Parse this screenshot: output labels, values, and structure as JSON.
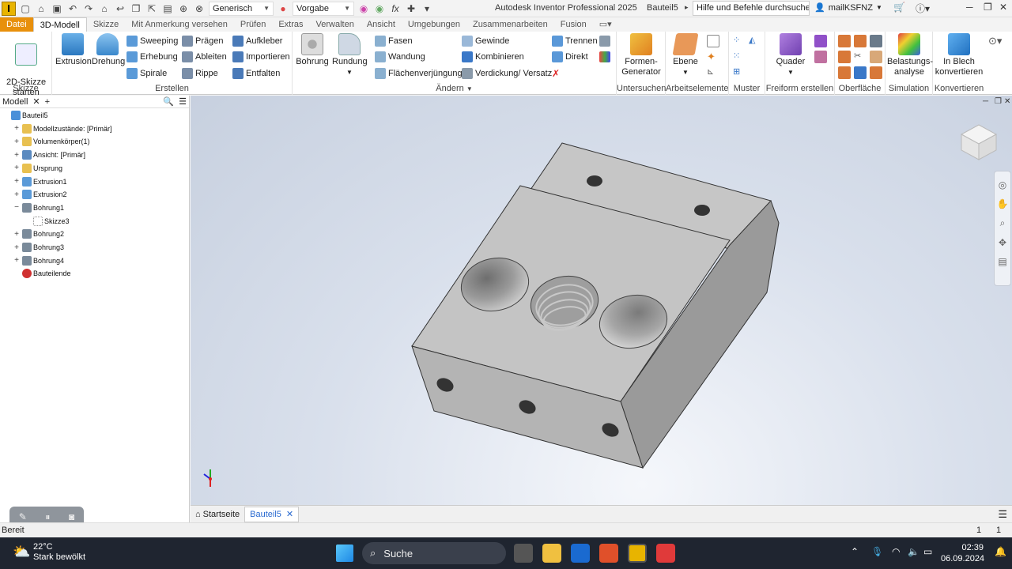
{
  "app": {
    "title": "Autodesk Inventor Professional 2025",
    "doc": "Bauteil5",
    "search_placeholder": "Hilfe und Befehle durchsuchen...",
    "user": "mailKSFNZ",
    "appearance": "Generisch",
    "material": "Vorgabe",
    "fx": "fx"
  },
  "menu_tabs": [
    "Datei",
    "3D-Modell",
    "Skizze",
    "Mit Anmerkung versehen",
    "Prüfen",
    "Extras",
    "Verwalten",
    "Ansicht",
    "Umgebungen",
    "Zusammenarbeiten",
    "Fusion"
  ],
  "ribbon": {
    "skizze": {
      "label": "Skizze",
      "btn": "2D-Skizze\nstarten"
    },
    "erstellen": {
      "label": "Erstellen",
      "extrusion": "Extrusion",
      "drehung": "Drehung",
      "sweeping": "Sweeping",
      "erhebung": "Erhebung",
      "spirale": "Spirale",
      "praegen": "Prägen",
      "ableiten": "Ableiten",
      "rippe": "Rippe",
      "aufkleber": "Aufkleber",
      "importieren": "Importieren",
      "entfalten": "Entfalten"
    },
    "aendern": {
      "label": "Ändern",
      "bohrung": "Bohrung",
      "rundung": "Rundung",
      "fasen": "Fasen",
      "wandung": "Wandung",
      "flaechen": "Flächenverjüngung",
      "gewinde": "Gewinde",
      "kombinieren": "Kombinieren",
      "verdickung": "Verdickung/ Versatz",
      "trennen": "Trennen",
      "direkt": "Direkt"
    },
    "untersuchen": {
      "label": "Untersuchen",
      "btn": "Formen-\nGenerator"
    },
    "arbeitselemente": {
      "label": "Arbeitselemente",
      "btn": "Ebene"
    },
    "muster": {
      "label": "Muster"
    },
    "freiform": {
      "label": "Freiform erstellen",
      "btn": "Quader"
    },
    "oberflaeche": {
      "label": "Oberfläche"
    },
    "simulation": {
      "label": "Simulation",
      "btn": "Belastungs-\nanalyse"
    },
    "konvertieren": {
      "label": "Konvertieren",
      "btn": "In Blech\nkonvertieren"
    }
  },
  "browser": {
    "tab": "Modell",
    "nodes": [
      {
        "label": "Bauteil5",
        "depth": 0,
        "expand": "",
        "icon": "part"
      },
      {
        "label": "Modellzustände: [Primär]",
        "depth": 1,
        "expand": "+",
        "icon": "folder"
      },
      {
        "label": "Volumenkörper(1)",
        "depth": 1,
        "expand": "+",
        "icon": "folder"
      },
      {
        "label": "Ansicht: [Primär]",
        "depth": 1,
        "expand": "+",
        "icon": "view"
      },
      {
        "label": "Ursprung",
        "depth": 1,
        "expand": "+",
        "icon": "folder"
      },
      {
        "label": "Extrusion1",
        "depth": 1,
        "expand": "+",
        "icon": "extrude"
      },
      {
        "label": "Extrusion2",
        "depth": 1,
        "expand": "+",
        "icon": "extrude"
      },
      {
        "label": "Bohrung1",
        "depth": 1,
        "expand": "−",
        "icon": "hole"
      },
      {
        "label": "Skizze3",
        "depth": 2,
        "expand": "",
        "icon": "sketch"
      },
      {
        "label": "Bohrung2",
        "depth": 1,
        "expand": "+",
        "icon": "hole"
      },
      {
        "label": "Bohrung3",
        "depth": 1,
        "expand": "+",
        "icon": "hole"
      },
      {
        "label": "Bohrung4",
        "depth": 1,
        "expand": "+",
        "icon": "hole"
      },
      {
        "label": "Bauteilende",
        "depth": 1,
        "expand": "",
        "icon": "end"
      }
    ]
  },
  "doc_tabs": {
    "home": "Startseite",
    "doc": "Bauteil5"
  },
  "status": {
    "text": "Bereit",
    "n1": "1",
    "n2": "1"
  },
  "taskbar": {
    "temp": "22°C",
    "weather": "Stark bewölkt",
    "search": "Suche",
    "time": "02:39",
    "date": "06.09.2024"
  }
}
